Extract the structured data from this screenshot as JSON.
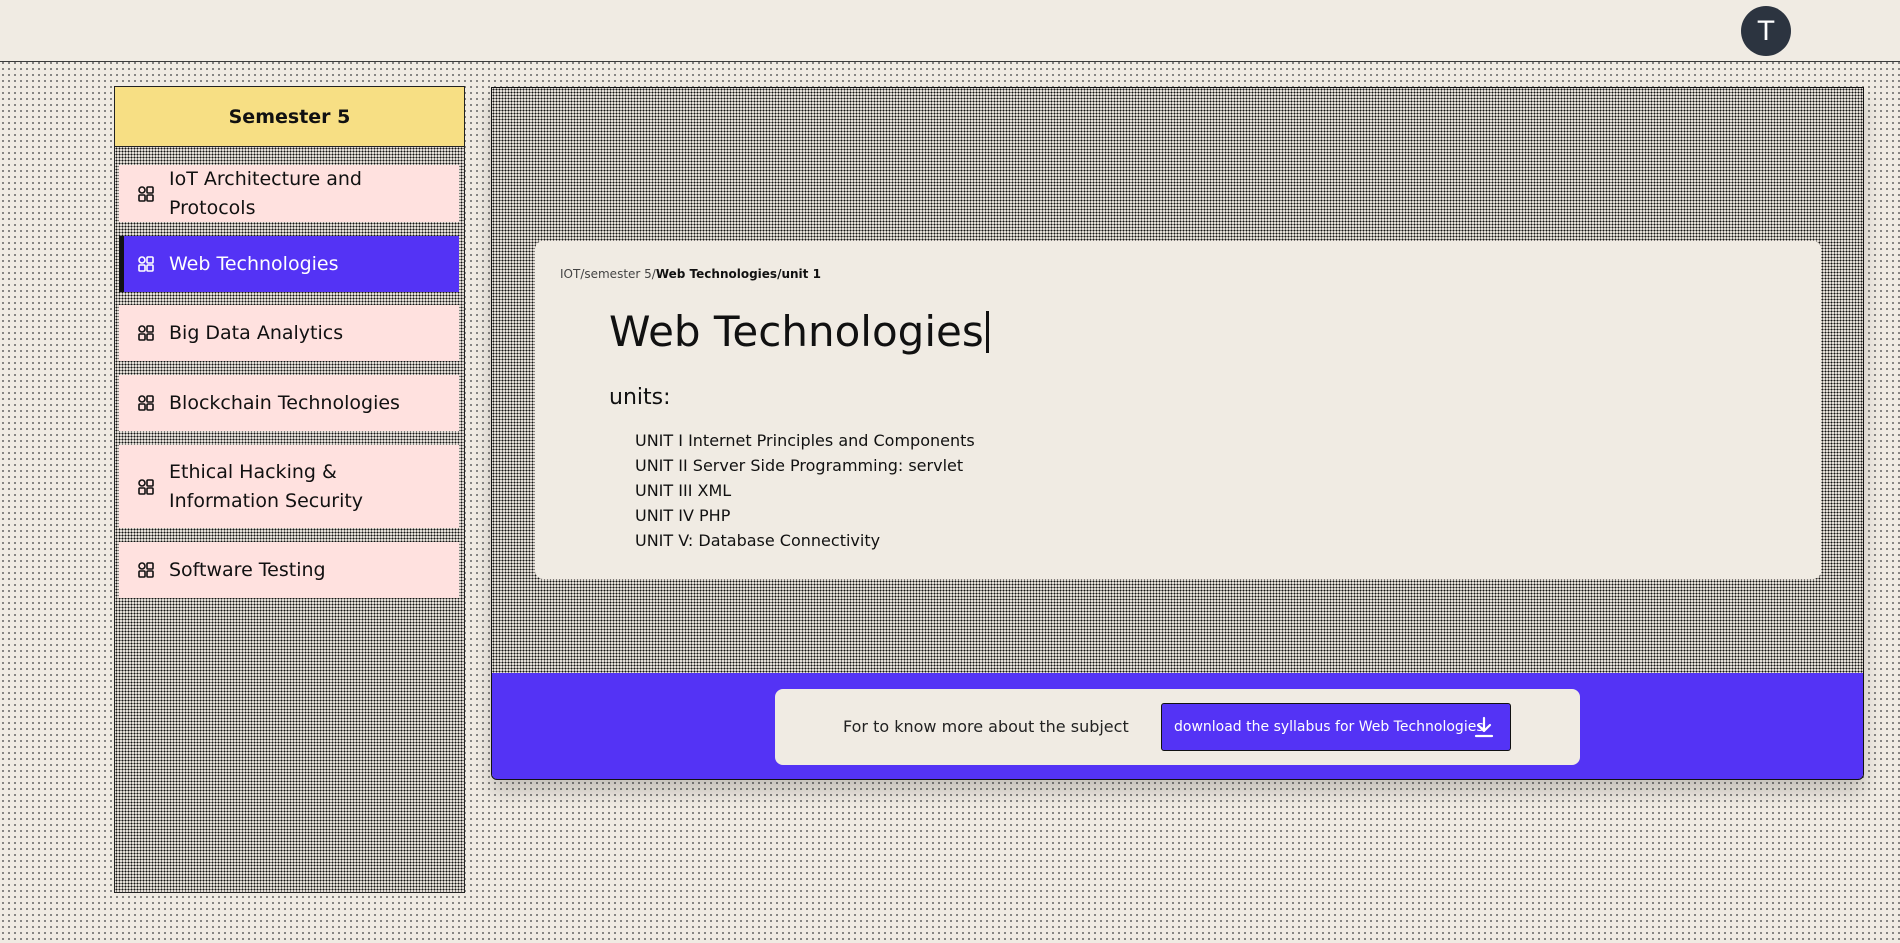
{
  "header": {
    "avatar_initial": "T"
  },
  "sidebar": {
    "semester_title": "Semester 5",
    "items": [
      {
        "label": "IoT Architecture and Protocols",
        "icon": "grid-apps-icon"
      },
      {
        "label": "Web Technologies",
        "icon": "grid-apps-icon",
        "active": true
      },
      {
        "label": "Big Data Analytics",
        "icon": "grid-apps-icon"
      },
      {
        "label": "Blockchain Technologies",
        "icon": "grid-apps-icon"
      },
      {
        "label": "Ethical Hacking & Information Security",
        "icon": "grid-apps-icon"
      },
      {
        "label": "Software Testing",
        "icon": "grid-apps-icon"
      }
    ]
  },
  "main": {
    "breadcrumb": {
      "prefix": "IOT/semester 5/",
      "current": "Web Technologies/unit 1"
    },
    "subject_title": "Web Technologies",
    "units_label": "units:",
    "units": [
      "UNIT I Internet Principles and Components",
      "UNIT II Server Side Programming: servlet",
      "UNIT III XML",
      "UNIT IV PHP",
      "UNIT V: Database Connectivity"
    ]
  },
  "footer": {
    "text": "For to know more about the subject",
    "download_label": "download the syllabus for Web Technologies",
    "download_icon": "download-arrow-icon"
  },
  "colors": {
    "accent": "#5433f5",
    "semester_header": "#f7df84",
    "nav_item_bg": "#ffe1df",
    "page_bg": "#f0ebe3"
  }
}
